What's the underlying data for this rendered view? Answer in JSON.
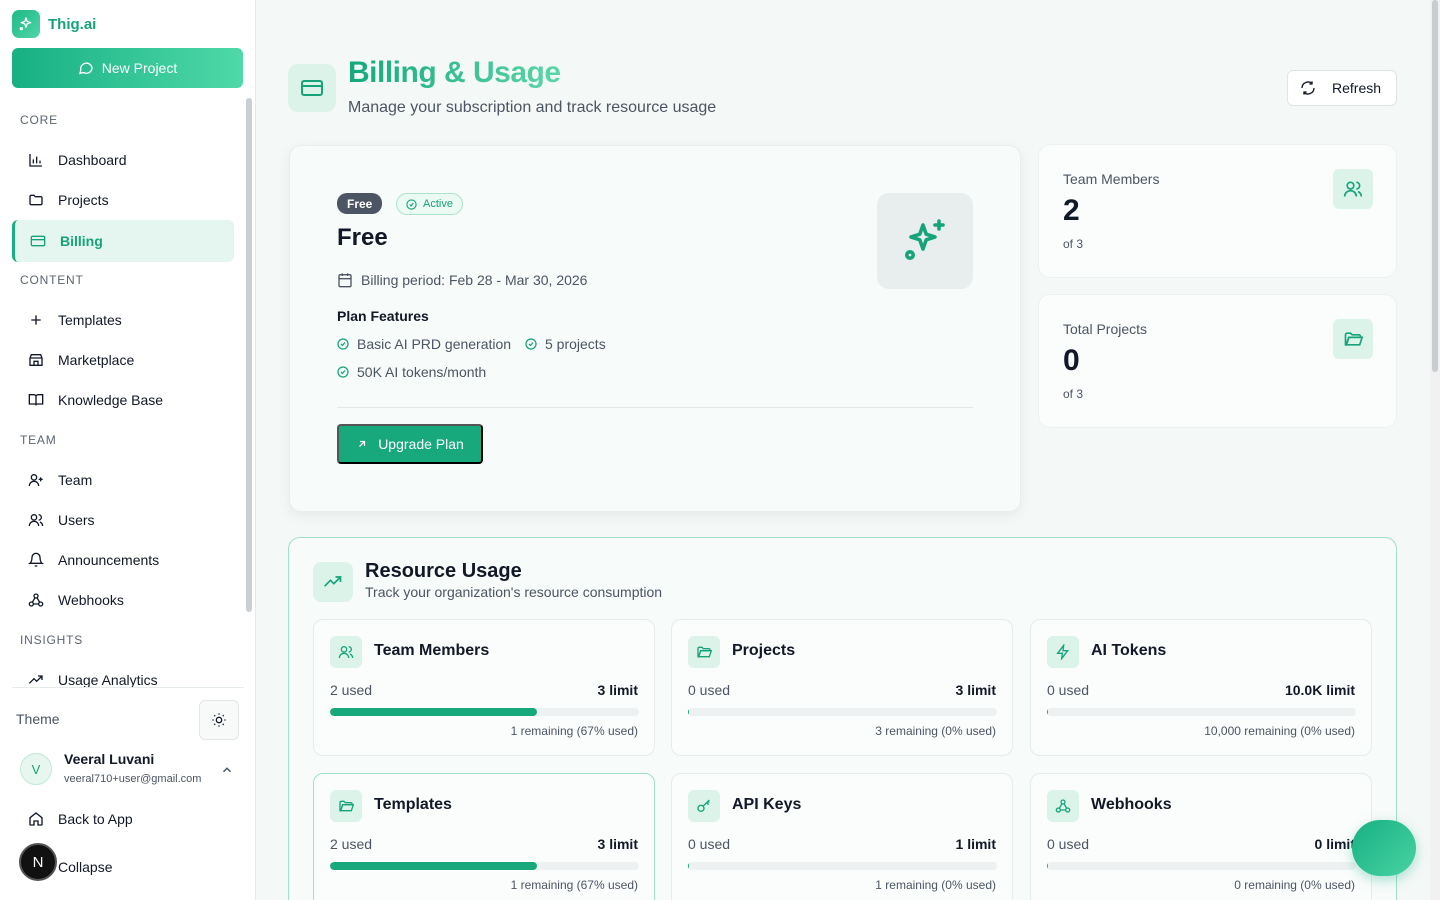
{
  "brand": {
    "name": "Thig.ai"
  },
  "sidebar": {
    "new_project_label": "New Project",
    "sections": [
      {
        "title": "CORE",
        "items": [
          {
            "label": "Dashboard",
            "icon": "bar-chart-icon"
          },
          {
            "label": "Projects",
            "icon": "folder-icon"
          },
          {
            "label": "Billing",
            "icon": "credit-card-icon",
            "active": true
          }
        ]
      },
      {
        "title": "CONTENT",
        "items": [
          {
            "label": "Templates",
            "icon": "plus-icon"
          },
          {
            "label": "Marketplace",
            "icon": "store-icon"
          },
          {
            "label": "Knowledge Base",
            "icon": "book-icon"
          }
        ]
      },
      {
        "title": "TEAM",
        "items": [
          {
            "label": "Team",
            "icon": "user-plus-icon"
          },
          {
            "label": "Users",
            "icon": "users-icon"
          },
          {
            "label": "Announcements",
            "icon": "bell-icon"
          },
          {
            "label": "Webhooks",
            "icon": "webhook-icon"
          }
        ]
      },
      {
        "title": "INSIGHTS",
        "items": [
          {
            "label": "Usage Analytics",
            "icon": "trending-up-icon"
          }
        ]
      }
    ],
    "theme_label": "Theme",
    "user": {
      "initial": "V",
      "name": "Veeral Luvani",
      "email": "veeral710+user@gmail.com"
    },
    "back_label": "Back to App",
    "collapse_label": "Collapse",
    "n_badge": "N"
  },
  "header": {
    "title": "Billing & Usage",
    "subtitle": "Manage your subscription and track resource usage",
    "refresh_label": "Refresh"
  },
  "plan": {
    "tier_badge": "Free",
    "status_badge": "Active",
    "name": "Free",
    "billing_period": "Billing period: Feb 28 - Mar 30, 2026",
    "features_title": "Plan Features",
    "features": [
      "Basic AI PRD generation",
      "5 projects",
      "50K AI tokens/month"
    ],
    "upgrade_label": "Upgrade Plan"
  },
  "stats": [
    {
      "label": "Team Members",
      "value": "2",
      "of": "of 3",
      "icon": "users-icon"
    },
    {
      "label": "Total Projects",
      "value": "0",
      "of": "of 3",
      "icon": "folder-open-icon"
    }
  ],
  "resource_usage": {
    "title": "Resource Usage",
    "subtitle": "Track your organization's resource consumption",
    "items": [
      {
        "name": "Team Members",
        "used": "2 used",
        "limit": "3 limit",
        "remaining": "1 remaining (67% used)",
        "fraction": 0.67,
        "icon": "users-icon"
      },
      {
        "name": "Projects",
        "used": "0 used",
        "limit": "3 limit",
        "remaining": "3 remaining (0% used)",
        "fraction": 0,
        "icon": "folder-open-icon"
      },
      {
        "name": "AI Tokens",
        "used": "0 used",
        "limit": "10.0K limit",
        "remaining": "10,000 remaining (0% used)",
        "fraction": 0,
        "icon": "zap-icon"
      },
      {
        "name": "Templates",
        "used": "2 used",
        "limit": "3 limit",
        "remaining": "1 remaining (67% used)",
        "fraction": 0.67,
        "icon": "folder-open-icon"
      },
      {
        "name": "API Keys",
        "used": "0 used",
        "limit": "1 limit",
        "remaining": "1 remaining (0% used)",
        "fraction": 0,
        "icon": "key-icon"
      },
      {
        "name": "Webhooks",
        "used": "0 used",
        "limit": "0 limit",
        "remaining": "0 remaining (0% used)",
        "fraction": 0,
        "icon": "webhook-icon"
      }
    ]
  },
  "colors": {
    "accent": "#17a97c",
    "accent_light": "#dcf3ea",
    "text": "#111827",
    "muted": "#4b5563"
  }
}
